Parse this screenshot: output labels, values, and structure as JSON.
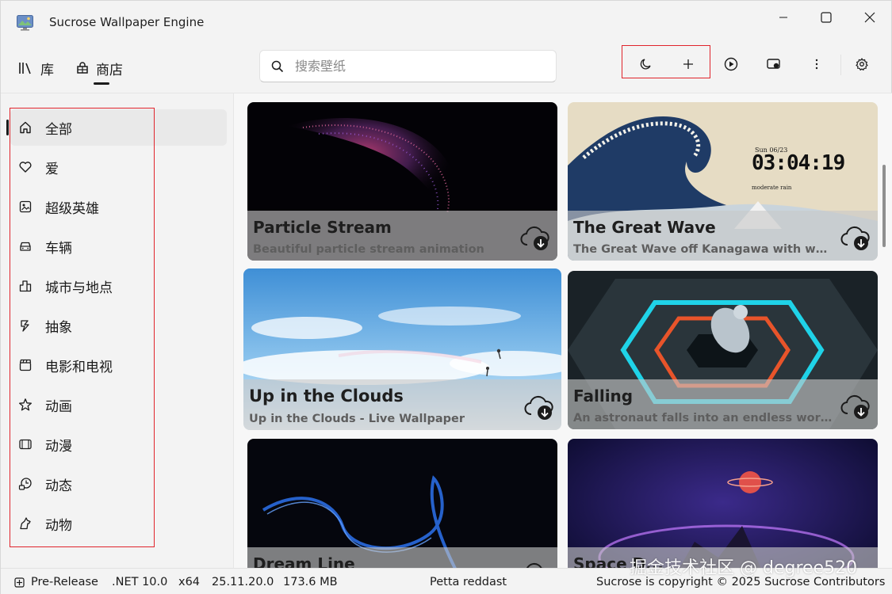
{
  "window": {
    "title": "Sucrose Wallpaper Engine",
    "icon": "monitor-icon"
  },
  "nav": {
    "library_label": "库",
    "store_label": "商店",
    "active": "store"
  },
  "search": {
    "placeholder": "搜索壁纸",
    "value": ""
  },
  "toolbar": {
    "icons": [
      "moon-icon",
      "add-icon",
      "play-icon",
      "wallpaper-icon",
      "more-icon",
      "settings-icon"
    ]
  },
  "sidebar": {
    "items": [
      {
        "label": "全部",
        "icon": "home-icon",
        "active": true
      },
      {
        "label": "爱",
        "icon": "heart-icon"
      },
      {
        "label": "超级英雄",
        "icon": "hero-icon"
      },
      {
        "label": "车辆",
        "icon": "car-icon"
      },
      {
        "label": "城市与地点",
        "icon": "city-icon"
      },
      {
        "label": "抽象",
        "icon": "abstract-icon"
      },
      {
        "label": "电影和电视",
        "icon": "movie-icon"
      },
      {
        "label": "动画",
        "icon": "animation-icon"
      },
      {
        "label": "动漫",
        "icon": "anime-icon"
      },
      {
        "label": "动态",
        "icon": "dynamic-icon"
      },
      {
        "label": "动物",
        "icon": "animal-icon"
      }
    ]
  },
  "cards": [
    {
      "title": "Particle Stream",
      "description": "Beautiful particle stream animation"
    },
    {
      "title": "The Great Wave",
      "description": "The Great Wave off Kanagawa with weat...",
      "clock_text": "03:04:19",
      "date_text": "Sun 06/23",
      "sub_text": "moderate rain"
    },
    {
      "title": "Up in the Clouds",
      "description": "Up in the Clouds - Live Wallpaper"
    },
    {
      "title": "Falling",
      "description": "An astronaut falls into an endless wormh..."
    },
    {
      "title": "Dream Line",
      "description": ""
    },
    {
      "title": "Space D...",
      "description": ""
    }
  ],
  "statusbar": {
    "channel": "Pre-Release",
    "runtime": ".NET 10.0",
    "arch": "x64",
    "version": "25.11.20.0",
    "memory": "173.6 MB",
    "center_text": "Petta reddast",
    "copyright": "Sucrose is copyright © 2025 Sucrose Contributors"
  },
  "watermark": "掘金技术社区 @ degree520",
  "colors": {
    "highlight_border": "#e0242c",
    "background": "#f3f3f3"
  }
}
